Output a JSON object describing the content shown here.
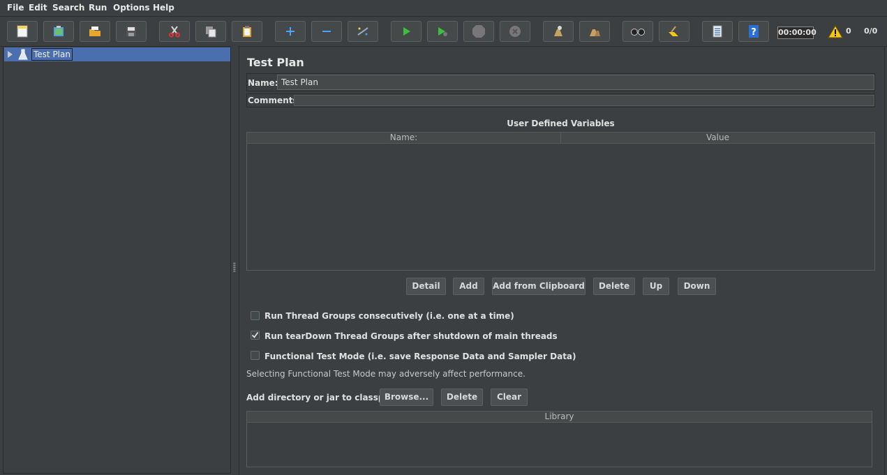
{
  "menu": [
    {
      "label": "File"
    },
    {
      "label": "Edit"
    },
    {
      "label": "Search"
    },
    {
      "label": "Run"
    },
    {
      "label": "Options"
    },
    {
      "label": "Help"
    }
  ],
  "toolbar": {
    "timer": "00:00:00",
    "warning_count": "0",
    "threads_ratio": "0/0"
  },
  "tree": {
    "root_label": "Test Plan"
  },
  "test_plan": {
    "title": "Test Plan",
    "name_label": "Name:",
    "name_value": "Test Plan",
    "comments_label": "Comments:",
    "udv_title": "User Defined Variables",
    "udv_columns": [
      "Name:",
      "Value"
    ],
    "udv_buttons": [
      "Detail",
      "Add",
      "Add from Clipboard",
      "Delete",
      "Up",
      "Down"
    ],
    "options": [
      {
        "label": "Run Thread Groups consecutively (i.e. one at a time)",
        "checked": false
      },
      {
        "label": "Run tearDown Thread Groups after shutdown of main threads",
        "checked": true
      },
      {
        "label": "Functional Test Mode (i.e. save Response Data and Sampler Data)",
        "checked": false
      }
    ],
    "functional_note": "Selecting Functional Test Mode may adversely affect performance.",
    "classpath_label": "Add directory or jar to classpath",
    "classpath_buttons": [
      "Browse...",
      "Delete",
      "Clear"
    ],
    "library_column": "Library"
  }
}
